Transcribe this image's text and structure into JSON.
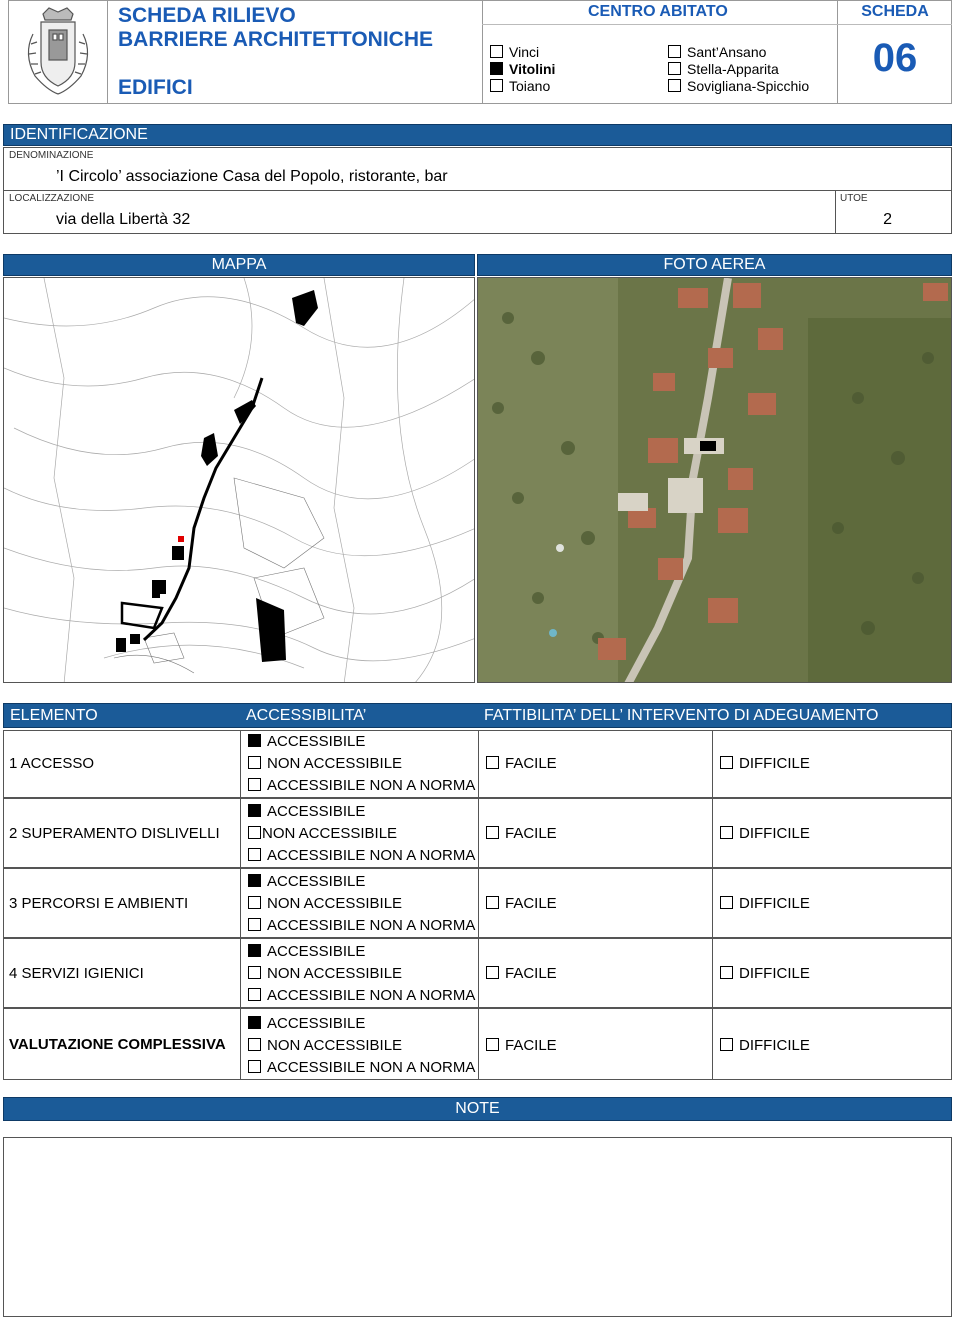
{
  "header": {
    "title_line1": "SCHEDA RILIEVO",
    "title_line2": "BARRIERE ARCHITETTONICHE",
    "subtitle": "EDIFICI",
    "centro_label": "CENTRO ABITATO",
    "centri": [
      {
        "label": "Vinci",
        "checked": false
      },
      {
        "label": "Vitolini",
        "checked": true
      },
      {
        "label": "Toiano",
        "checked": false
      },
      {
        "label": "Sant’Ansano",
        "checked": false
      },
      {
        "label": "Stella-Apparita",
        "checked": false
      },
      {
        "label": "Sovigliana-Spicchio",
        "checked": false
      }
    ],
    "scheda_label": "SCHEDA",
    "scheda_number": "06"
  },
  "identificazione": {
    "section_title": "IDENTIFICAZIONE",
    "denominazione_label": "DENOMINAZIONE",
    "denominazione_value": "’I Circolo’ associazione Casa del Popolo, ristorante, bar",
    "localizzazione_label": "LOCALIZZAZIONE",
    "localizzazione_value": "via della Libertà 32",
    "utoe_label": "UTOE",
    "utoe_value": "2"
  },
  "maps": {
    "mappa_label": "MAPPA",
    "foto_label": "FOTO AEREA"
  },
  "table": {
    "col_elemento": "ELEMENTO",
    "col_accessibilita": "ACCESSIBILITA’",
    "col_fattibilita": "FATTIBILITA’ DELL’ INTERVENTO DI ADEGUAMENTO",
    "opt_accessibile": "ACCESSIBILE",
    "opt_non_accessibile": "NON ACCESSIBILE",
    "opt_non_a_norma": "ACCESSIBILE NON A NORMA",
    "opt_facile": "FACILE",
    "opt_difficile": "DIFFICILE",
    "rows": [
      {
        "label": "1 ACCESSO",
        "selected": "accessibile"
      },
      {
        "label": "2 SUPERAMENTO DISLIVELLI",
        "selected": "accessibile"
      },
      {
        "label": "3 PERCORSI E AMBIENTI",
        "selected": "accessibile"
      },
      {
        "label": "4 SERVIZI IGIENICI",
        "selected": "accessibile"
      },
      {
        "label": "VALUTAZIONE COMPLESSIVA",
        "selected": "accessibile"
      }
    ]
  },
  "note": {
    "title": "NOTE"
  }
}
